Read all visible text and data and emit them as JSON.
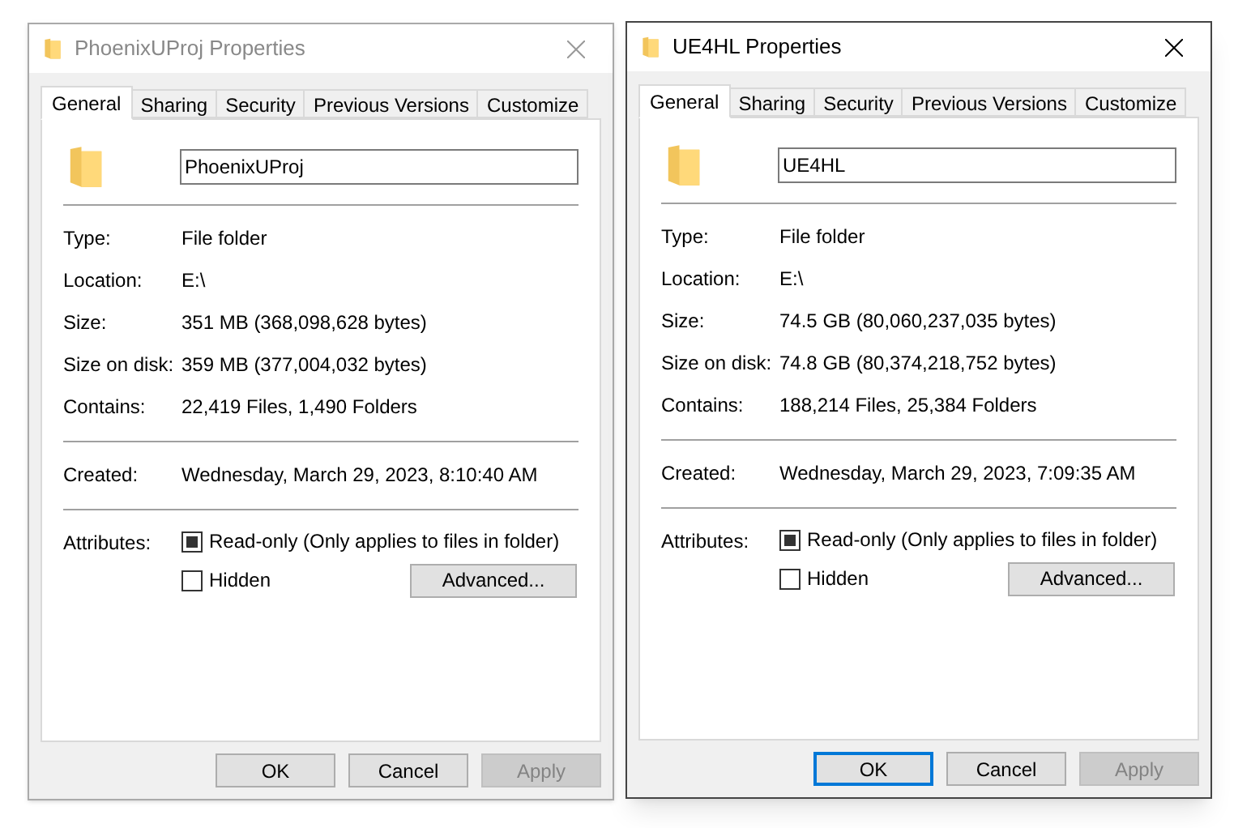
{
  "windows": [
    {
      "title": "PhoenixUProj Properties",
      "active": false,
      "tabs": [
        {
          "label": "General",
          "selected": true
        },
        {
          "label": "Sharing",
          "selected": false
        },
        {
          "label": "Security",
          "selected": false
        },
        {
          "label": "Previous Versions",
          "selected": false
        },
        {
          "label": "Customize",
          "selected": false
        }
      ],
      "name": "PhoenixUProj",
      "groups": [
        [
          {
            "label": "Type:",
            "value": "File folder"
          },
          {
            "label": "Location:",
            "value": "E:\\"
          },
          {
            "label": "Size:",
            "value": "351 MB (368,098,628 bytes)"
          },
          {
            "label": "Size on disk:",
            "value": "359 MB (377,004,032 bytes)"
          },
          {
            "label": "Contains:",
            "value": "22,419 Files, 1,490 Folders"
          }
        ],
        [
          {
            "label": "Created:",
            "value": "Wednesday, March 29, 2023, 8:10:40 AM"
          }
        ]
      ],
      "attributes_label": "Attributes:",
      "attributes": [
        {
          "label": "Read-only (Only applies to files in folder)",
          "checked": true
        },
        {
          "label": "Hidden",
          "checked": false
        }
      ],
      "advanced": "Advanced...",
      "buttons": [
        {
          "label": "OK",
          "default": false,
          "disabled": false
        },
        {
          "label": "Cancel",
          "default": false,
          "disabled": false
        },
        {
          "label": "Apply",
          "default": false,
          "disabled": true
        }
      ]
    },
    {
      "title": "UE4HL Properties",
      "active": true,
      "tabs": [
        {
          "label": "General",
          "selected": true
        },
        {
          "label": "Sharing",
          "selected": false
        },
        {
          "label": "Security",
          "selected": false
        },
        {
          "label": "Previous Versions",
          "selected": false
        },
        {
          "label": "Customize",
          "selected": false
        }
      ],
      "name": "UE4HL",
      "groups": [
        [
          {
            "label": "Type:",
            "value": "File folder"
          },
          {
            "label": "Location:",
            "value": "E:\\"
          },
          {
            "label": "Size:",
            "value": "74.5 GB (80,060,237,035 bytes)"
          },
          {
            "label": "Size on disk:",
            "value": "74.8 GB (80,374,218,752 bytes)"
          },
          {
            "label": "Contains:",
            "value": "188,214 Files, 25,384 Folders"
          }
        ],
        [
          {
            "label": "Created:",
            "value": "Wednesday, March 29, 2023, 7:09:35 AM"
          }
        ]
      ],
      "attributes_label": "Attributes:",
      "attributes": [
        {
          "label": "Read-only (Only applies to files in folder)",
          "checked": true
        },
        {
          "label": "Hidden",
          "checked": false
        }
      ],
      "advanced": "Advanced...",
      "buttons": [
        {
          "label": "OK",
          "default": true,
          "disabled": false
        },
        {
          "label": "Cancel",
          "default": false,
          "disabled": false
        },
        {
          "label": "Apply",
          "default": false,
          "disabled": true
        }
      ]
    }
  ]
}
